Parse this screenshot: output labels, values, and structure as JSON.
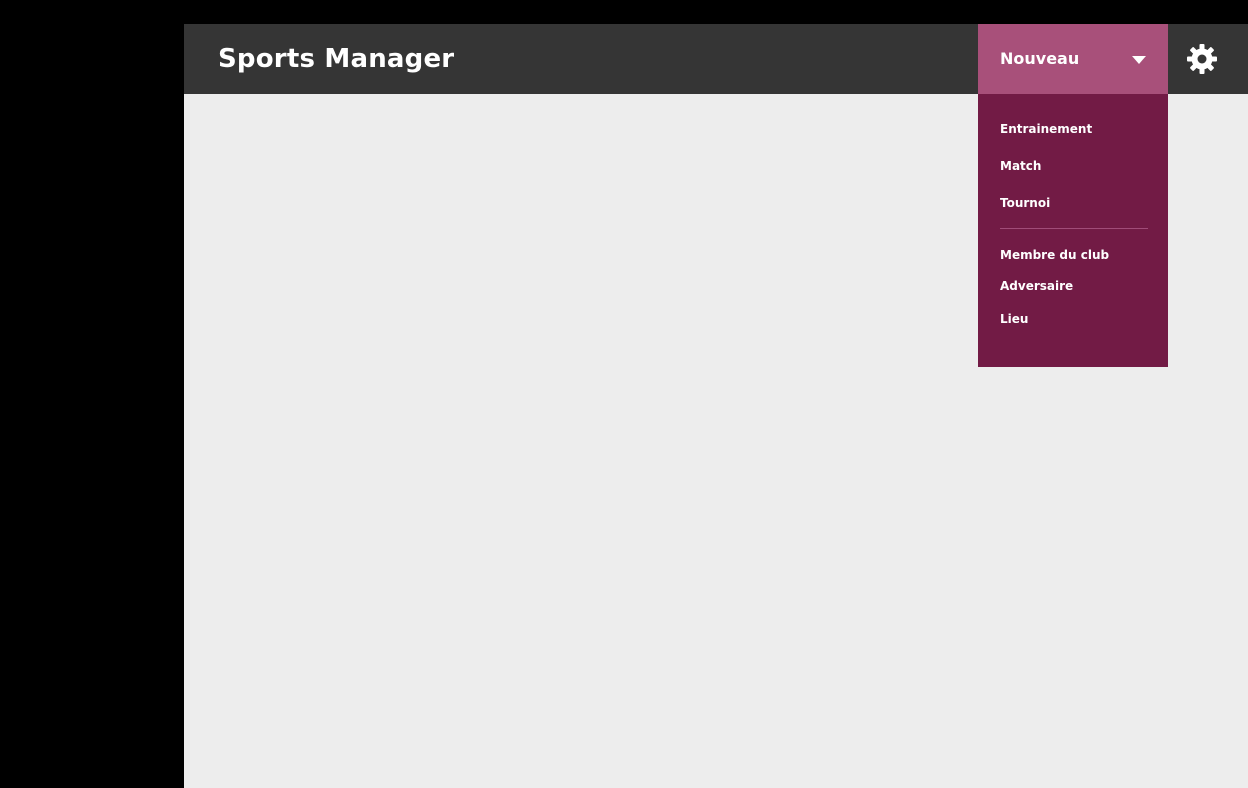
{
  "app": {
    "title": "Sports Manager"
  },
  "header": {
    "new_button_label": "Nouveau",
    "settings_icon": "gear-icon",
    "chevron_icon": "chevron-down-icon"
  },
  "dropdown": {
    "group1": [
      "Entrainement",
      "Match",
      "Tournoi"
    ],
    "group2": [
      "Membre du club",
      "Adversaire",
      "Lieu"
    ]
  },
  "colors": {
    "header_bg": "#353535",
    "accent": "#a8507a",
    "menu_bg": "#721b45",
    "content_bg": "#ededed"
  }
}
